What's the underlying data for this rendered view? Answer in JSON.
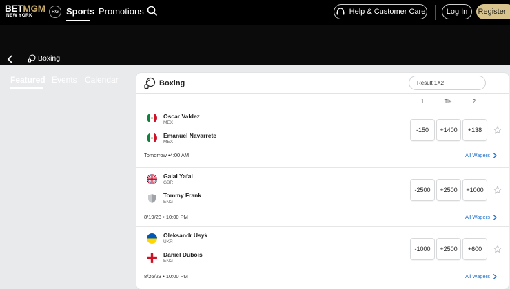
{
  "brand": {
    "name_part1": "BET",
    "name_part2": "MGM",
    "region": "NEW YORK",
    "badge": "RG",
    "accent": "#c6aa6c"
  },
  "nav": {
    "sports": "Sports",
    "promotions": "Promotions"
  },
  "header": {
    "help": "Help & Customer Care",
    "login": "Log In",
    "register": "Register"
  },
  "breadcrumb": {
    "label": "Boxing"
  },
  "tabs": [
    "Featured",
    "Events",
    "Calendar"
  ],
  "card": {
    "title": "Boxing",
    "market": "Result 1X2",
    "columns": [
      "1",
      "Tie",
      "2"
    ],
    "events": [
      {
        "p1": {
          "name": "Oscar Valdez",
          "country": "MEX",
          "flag": "mexico-flag-icon"
        },
        "p2": {
          "name": "Emanuel Navarrete",
          "country": "MEX",
          "flag": "mexico-flag-icon"
        },
        "odds": [
          "-150",
          "+1400",
          "+138"
        ],
        "time": "Tomorrow •4:00 AM",
        "wagers": "All Wagers"
      },
      {
        "p1": {
          "name": "Galal Yafai",
          "country": "GBR",
          "flag": "uk-flag-icon"
        },
        "p2": {
          "name": "Tommy Frank",
          "country": "ENG",
          "flag": "shield-icon"
        },
        "odds": [
          "-2500",
          "+2500",
          "+1000"
        ],
        "time": "8/19/23 • 10:00 PM",
        "wagers": "All Wagers"
      },
      {
        "p1": {
          "name": "Oleksandr Usyk",
          "country": "UKR",
          "flag": "ukraine-flag-icon"
        },
        "p2": {
          "name": "Daniel Dubois",
          "country": "ENG",
          "flag": "england-flag-icon"
        },
        "odds": [
          "-1000",
          "+2500",
          "+600"
        ],
        "time": "8/26/23 • 10:00 PM",
        "wagers": "All Wagers"
      }
    ]
  }
}
